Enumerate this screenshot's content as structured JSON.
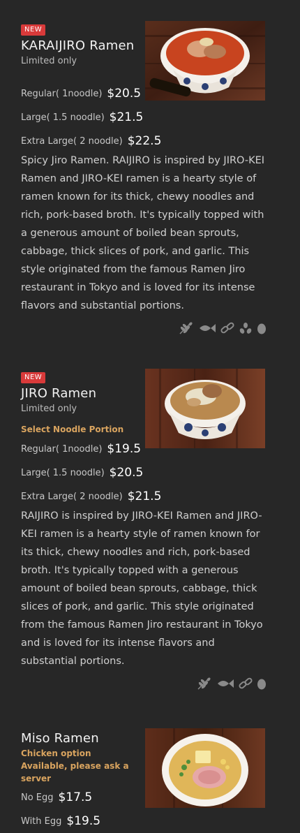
{
  "items": [
    {
      "badge": "NEW",
      "title": "KARAIJIRO Ramen",
      "subtitle": "Limited only",
      "sizes": [
        {
          "label": "Regular( 1noodle)",
          "price": "$20.5"
        },
        {
          "label": "Large( 1.5 noodle)",
          "price": "$21.5"
        },
        {
          "label": "Extra Large( 2 noodle)",
          "price": "$22.5"
        }
      ],
      "description": "Spicy Jiro Ramen. RAIJIRO is inspired by JIRO-KEI Ramen and JIRO-KEI ramen is a hearty style of ramen known for its thick, chewy noodles and rich, pork-based broth. It's typically topped with a generous amount of boiled bean sprouts, cabbage, thick slices of pork, and garlic. This style originated from the famous Ramen Jiro restaurant in Tokyo and is loved for its intense flavors and substantial portions.",
      "allergen_icons": [
        "wheat-icon",
        "fish-icon",
        "chain-icon",
        "sesame-icon",
        "egg-icon"
      ]
    },
    {
      "badge": "NEW",
      "title": "JIRO Ramen",
      "subtitle": "Limited only",
      "notice": "Select Noodle Portion",
      "sizes": [
        {
          "label": "Regular( 1noodle)",
          "price": "$19.5"
        },
        {
          "label": "Large( 1.5 noodle)",
          "price": "$20.5"
        },
        {
          "label": "Extra Large( 2 noodle)",
          "price": "$21.5"
        }
      ],
      "description": "RAIJIRO is inspired by JIRO-KEI Ramen and JIRO-KEI ramen is a hearty style of ramen known for its thick, chewy noodles and rich, pork-based broth. It's typically topped with a generous amount of boiled bean sprouts, cabbage, thick slices of pork, and garlic. This style originated from the famous Ramen Jiro restaurant in Tokyo and is loved for its intense flavors and substantial portions.",
      "allergen_icons": [
        "wheat-icon",
        "fish-icon",
        "chain-icon",
        "egg-icon"
      ]
    },
    {
      "title": "Miso Ramen",
      "notice": "Chicken option Available, please ask a server",
      "sizes": [
        {
          "label": "No Egg",
          "price": "$17.5"
        },
        {
          "label": "With Egg",
          "price": "$19.5"
        }
      ]
    }
  ],
  "colors": {
    "background": "#272727",
    "badge": "#d93a3a",
    "notice": "#d9a45f",
    "icon": "#8a8a8a"
  }
}
